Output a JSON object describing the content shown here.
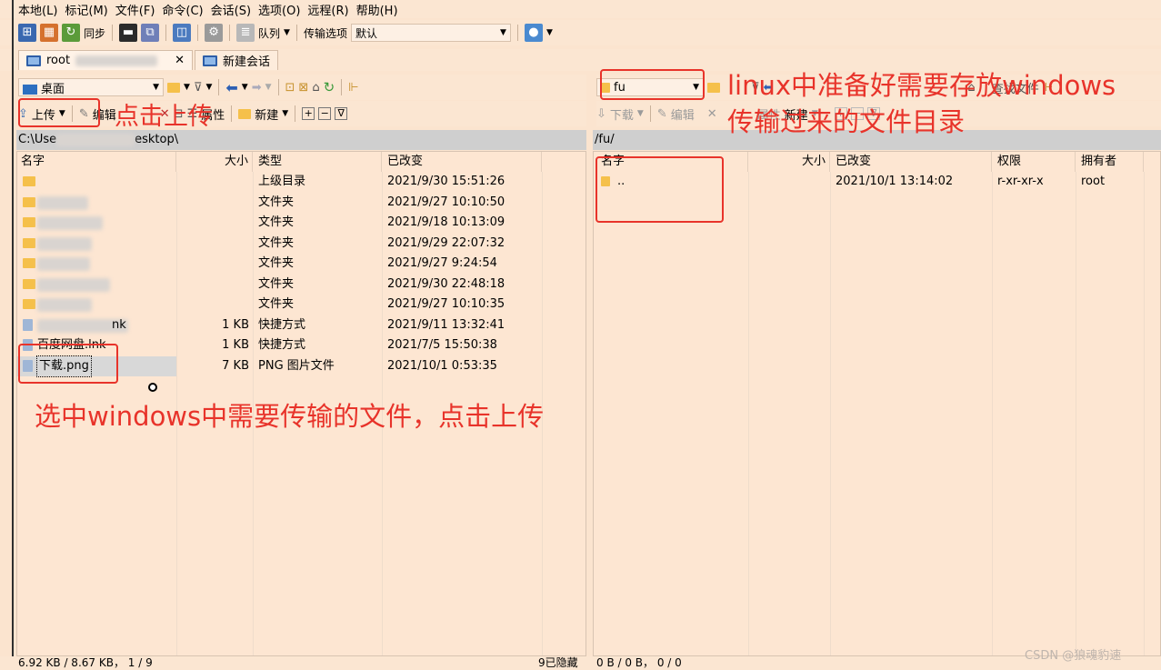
{
  "menu": [
    "本地(L)",
    "标记(M)",
    "文件(F)",
    "命令(C)",
    "会话(S)",
    "选项(O)",
    "远程(R)",
    "帮助(H)"
  ],
  "toolbar": {
    "sync_label": "同步",
    "queue_label": "队列",
    "transfer_options_label": "传输选项",
    "transfer_preset": "默认"
  },
  "tabs": [
    {
      "label": "root"
    },
    {
      "label": "新建会话"
    }
  ],
  "left": {
    "location": "桌面",
    "upload_label": "上传",
    "edit_label": "编辑",
    "properties_label": "属性",
    "new_label": "新建",
    "path": "C:\\Use",
    "path_tail": "esktop\\",
    "columns": [
      "名字",
      "大小",
      "类型",
      "已改变"
    ],
    "rows": [
      {
        "name": "",
        "size": "",
        "type": "上级目录",
        "modified": "2021/9/30  15:51:26"
      },
      {
        "name": "",
        "size": "",
        "type": "文件夹",
        "modified": "2021/9/27  10:10:50"
      },
      {
        "name": "",
        "size": "",
        "type": "文件夹",
        "modified": "2021/9/18  10:13:09"
      },
      {
        "name": "",
        "size": "",
        "type": "文件夹",
        "modified": "2021/9/29  22:07:32"
      },
      {
        "name": "",
        "size": "",
        "type": "文件夹",
        "modified": "2021/9/27  9:24:54"
      },
      {
        "name": "",
        "size": "",
        "type": "文件夹",
        "modified": "2021/9/30  22:48:18"
      },
      {
        "name": "",
        "size": "",
        "type": "文件夹",
        "modified": "2021/9/27  10:10:35"
      },
      {
        "name": "nk",
        "size": "1 KB",
        "type": "快捷方式",
        "modified": "2021/9/11  13:32:41"
      },
      {
        "name": "百度网盘.lnk",
        "size": "1 KB",
        "type": "快捷方式",
        "modified": "2021/7/5  15:50:38"
      },
      {
        "name": "下载.png",
        "size": "7 KB",
        "type": "PNG 图片文件",
        "modified": "2021/10/1  0:53:35"
      }
    ]
  },
  "right": {
    "location": "fu",
    "download_label": "下载",
    "edit_label": "编辑",
    "properties_label": "属性",
    "new_label": "新建",
    "find_label": "查找文件",
    "path": "/fu/",
    "columns": [
      "名字",
      "大小",
      "已改变",
      "权限",
      "拥有者"
    ],
    "rows": [
      {
        "name": "..",
        "size": "",
        "modified": "2021/10/1  13:14:02",
        "rights": "r-xr-xr-x",
        "owner": "root"
      }
    ]
  },
  "annotations": {
    "click_upload": "点击上传",
    "linux_dir_line1": "linux中准备好需要存放windows",
    "linux_dir_line2": "传输过来的文件目录",
    "select_file": "选中windows中需要传输的文件，点击上传",
    "color": "#e8332a"
  },
  "status": {
    "left": "6.92 KB / 8.67 KB，  1 / 9",
    "hidden": "9已隐藏",
    "right": "0 B / 0 B，  0 / 0"
  },
  "watermark": "CSDN @狼魂豹速"
}
